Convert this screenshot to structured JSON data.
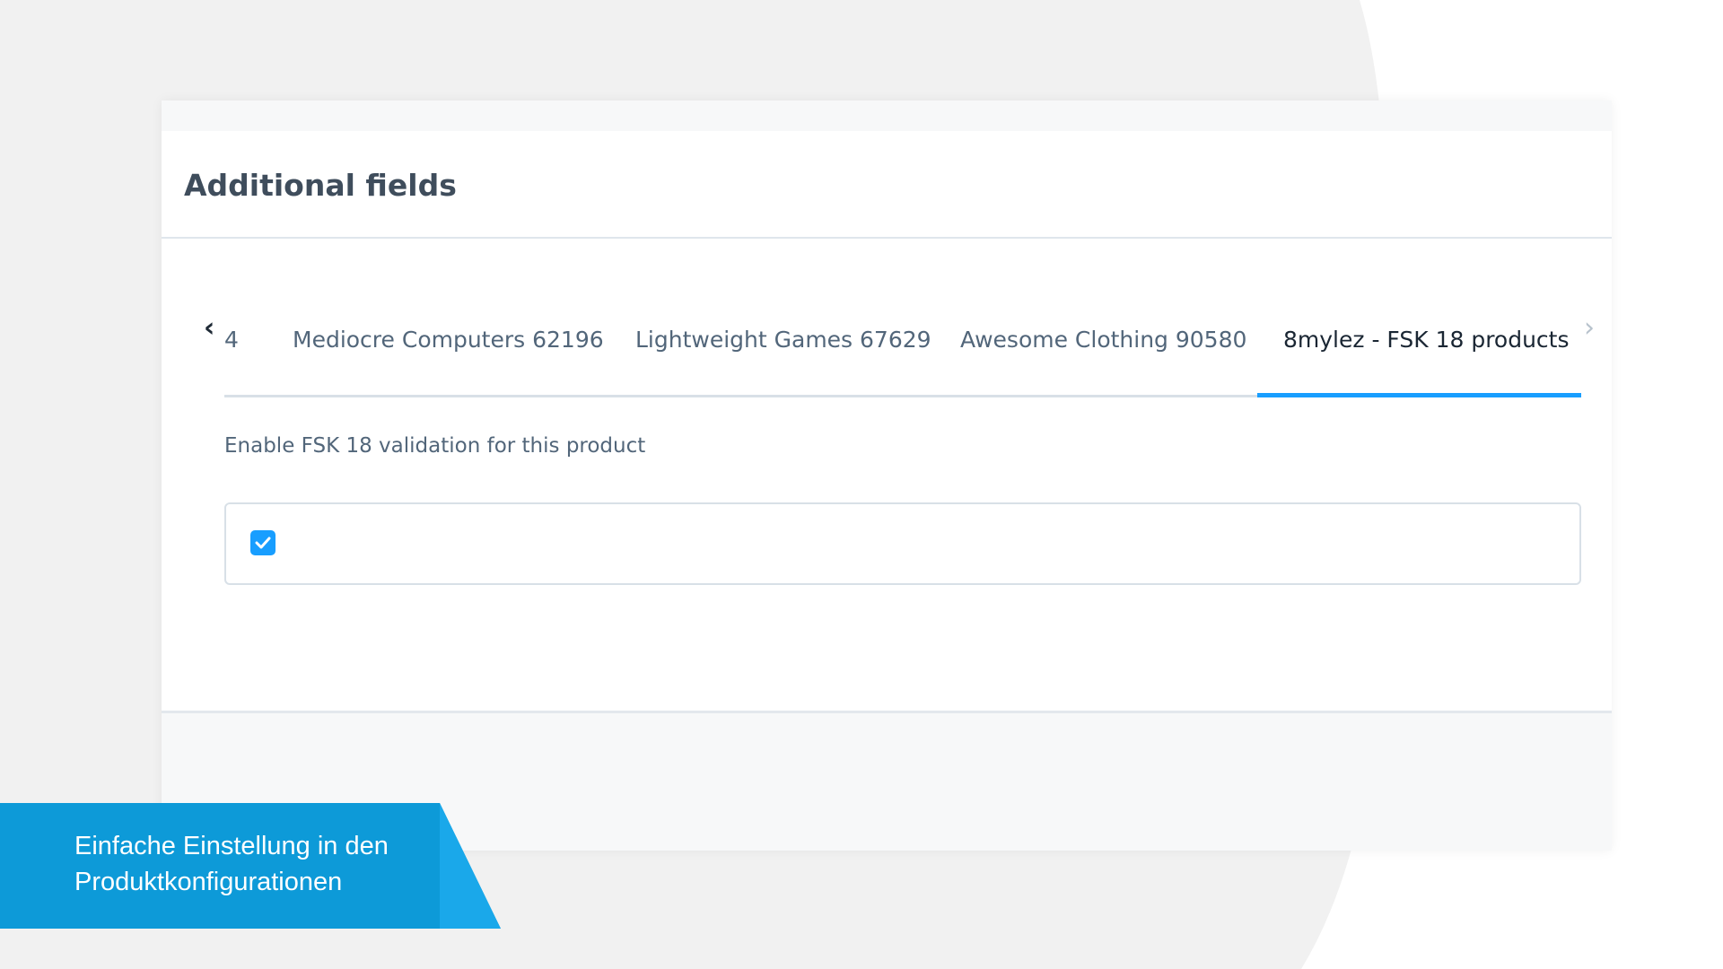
{
  "colors": {
    "page_background": "#f1f1f1",
    "accent_blue": "#189eff",
    "banner_blue": "#0d9ad8",
    "title_text": "#3f4d5c",
    "tab_text": "#52667a",
    "active_tab_text": "#1a2633"
  },
  "card": {
    "title": "Additional fields"
  },
  "tabs": {
    "prev_icon": "chevron-left-icon",
    "next_icon": "chevron-right-icon",
    "items": [
      {
        "label": "4",
        "active": false
      },
      {
        "label": "Mediocre Computers 62196",
        "active": false
      },
      {
        "label": "Lightweight Games 67629",
        "active": false
      },
      {
        "label": "Awesome Clothing 90580",
        "active": false
      },
      {
        "label": "8mylez - FSK 18 products",
        "active": true
      }
    ]
  },
  "field": {
    "label": "Enable FSK 18 validation for this product",
    "checked": true,
    "check_icon": "checkmark-icon"
  },
  "banner": {
    "line1": "Einfache Einstellung in den",
    "line2": "Produktkonfigurationen"
  }
}
